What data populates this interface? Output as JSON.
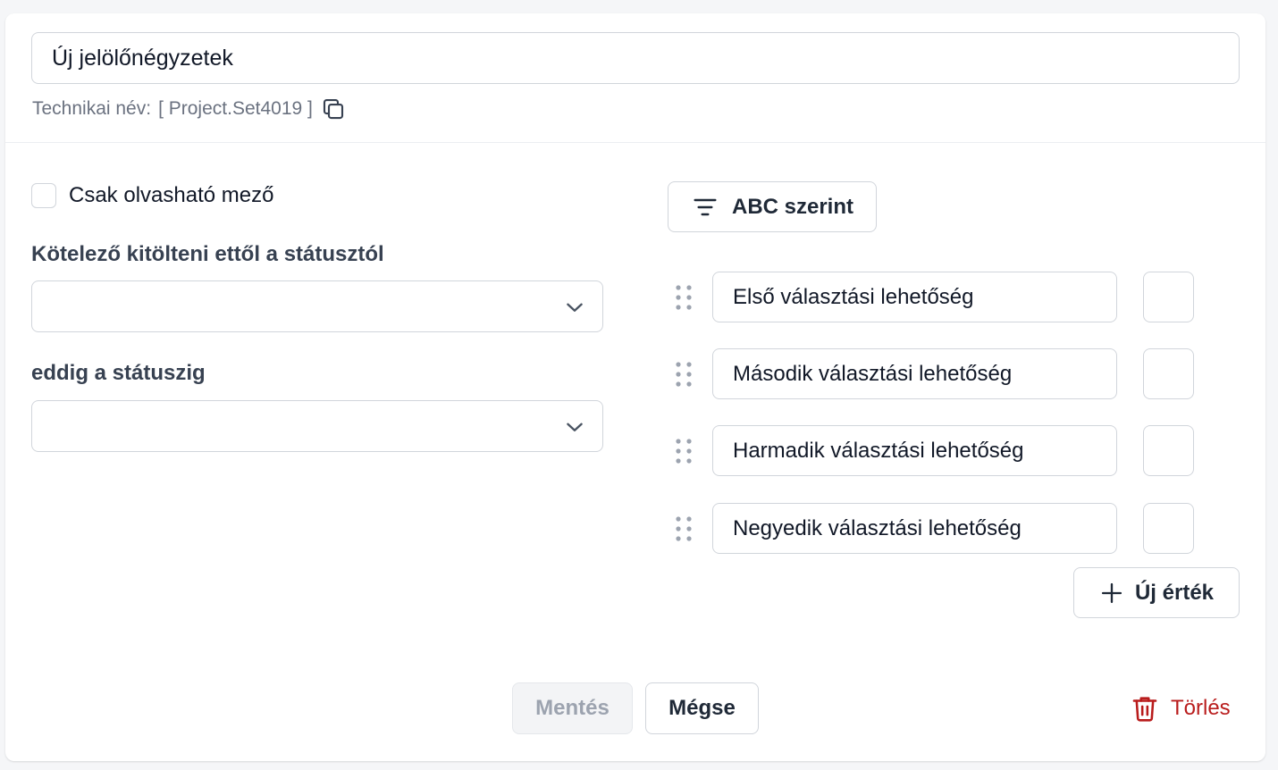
{
  "header": {
    "name_value": "Új jelölőnégyzetek",
    "technical_name_label": "Technikai név:",
    "technical_name_value": "[ Project.Set4019 ]"
  },
  "settings": {
    "readonly_label": "Csak olvasható mező",
    "required_from_label": "Kötelező kitölteni ettől a státusztól",
    "required_from_value": "",
    "until_label": "eddig a státuszig",
    "until_value": ""
  },
  "options": {
    "sort_button_label": "ABC szerint",
    "items": [
      {
        "value": "Első választási lehetőség"
      },
      {
        "value": "Második választási lehetőség"
      },
      {
        "value": "Harmadik választási lehetőség"
      },
      {
        "value": "Negyedik választási lehetőség"
      }
    ],
    "add_button_label": "Új érték"
  },
  "footer": {
    "save_label": "Mentés",
    "cancel_label": "Mégse",
    "delete_label": "Törlés"
  },
  "colors": {
    "danger": "#b91c1c",
    "border": "#d1d5db",
    "muted_text": "#6b7280"
  },
  "icons": [
    "copy-icon",
    "chevron-down-icon",
    "filter-lines-icon",
    "drag-handle-icon",
    "plus-icon",
    "trash-icon"
  ]
}
